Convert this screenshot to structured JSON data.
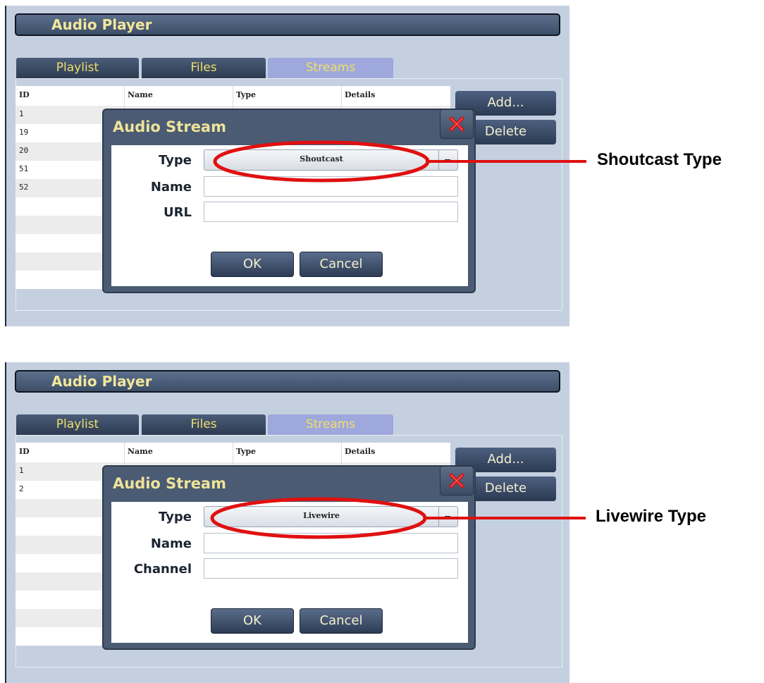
{
  "colors": {
    "highlight": "#e01010"
  },
  "screens": [
    {
      "app_title": "Audio Player",
      "tabs": [
        {
          "label": "Playlist"
        },
        {
          "label": "Files"
        },
        {
          "label": "Streams",
          "active": true
        }
      ],
      "columns": [
        "ID",
        "Name",
        "Type",
        "Details"
      ],
      "rows": [
        "1",
        "19",
        "20",
        "51",
        "52"
      ],
      "buttons": {
        "add": "Add...",
        "delete": "Delete"
      },
      "dialog": {
        "title": "Audio Stream",
        "type_label": "Type",
        "type_value": "Shoutcast",
        "field1_label": "Name",
        "field2_label": "URL",
        "ok": "OK",
        "cancel": "Cancel"
      },
      "callout": "Shoutcast Type"
    },
    {
      "app_title": "Audio Player",
      "tabs": [
        {
          "label": "Playlist"
        },
        {
          "label": "Files"
        },
        {
          "label": "Streams",
          "active": true
        }
      ],
      "columns": [
        "ID",
        "Name",
        "Type",
        "Details"
      ],
      "rows": [
        "1",
        "2"
      ],
      "buttons": {
        "add": "Add...",
        "delete": "Delete"
      },
      "dialog": {
        "title": "Audio Stream",
        "type_label": "Type",
        "type_value": "Livewire",
        "field1_label": "Name",
        "field2_label": "Channel",
        "ok": "OK",
        "cancel": "Cancel"
      },
      "callout": "Livewire Type"
    }
  ]
}
